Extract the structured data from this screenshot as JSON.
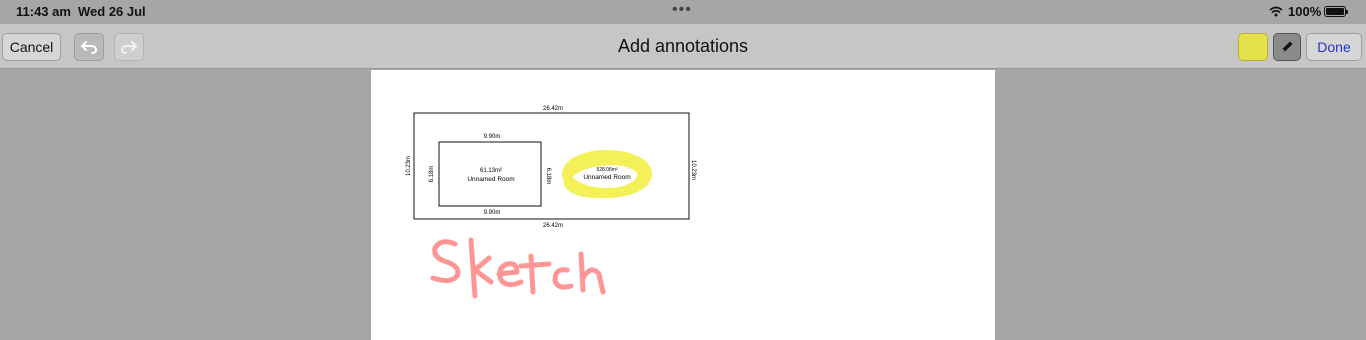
{
  "status": {
    "time": "11:43 am",
    "date": "Wed 26 Jul",
    "battery": "100%",
    "battery_level": 1.0
  },
  "toolbar": {
    "cancel_label": "Cancel",
    "title": "Add annotations",
    "done_label": "Done",
    "highlight_color": "#e5e14d"
  },
  "plan": {
    "outer_top": "26.42m",
    "outer_bottom": "26.42m",
    "outer_left": "10.23m",
    "outer_right": "10.23m",
    "room1_top": "9.90m",
    "room1_bottom": "9.90m",
    "room1_left": "6.18m",
    "room1_right": "6.18m",
    "room1_area": "61.13m²",
    "room1_name": "Unnamed Room",
    "room2_area": "528.06m²",
    "room2_name": "Unnamed Room"
  },
  "annotations": {
    "handwritten_text": "Sketch",
    "highlight_color": "#f3ee3a",
    "pen_color": "#ff8a8a"
  }
}
